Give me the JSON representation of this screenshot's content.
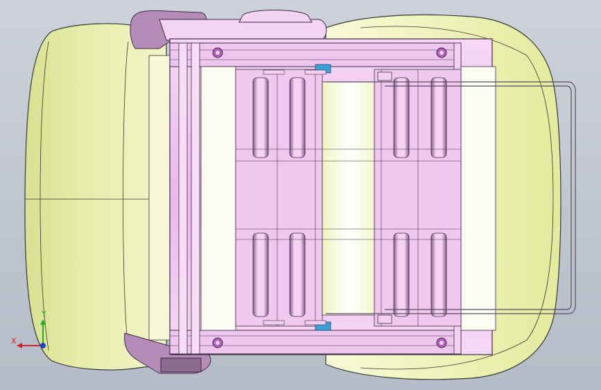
{
  "viewport": {
    "background_top": "#c9ced6",
    "background_bottom": "#b8bfc9",
    "colors": {
      "cushion": "#eef2b0",
      "cushion_shade": "#dfe68e",
      "cushion_edge": "#2e3a2e",
      "frame": "#f0c8f0",
      "frame_dark": "#c888cc",
      "frame_edge": "#3c2a44",
      "rail": "#e8b8e8",
      "bolt": "#b060b8",
      "clip": "#3aa0d8",
      "white_pad": "#fbfdf0",
      "handle": "#a58aa8"
    }
  },
  "triad": {
    "x_label": "X",
    "y_label": "Y",
    "x_color": "#d42020",
    "y_color": "#20b020",
    "z_color": "#2040d0"
  }
}
